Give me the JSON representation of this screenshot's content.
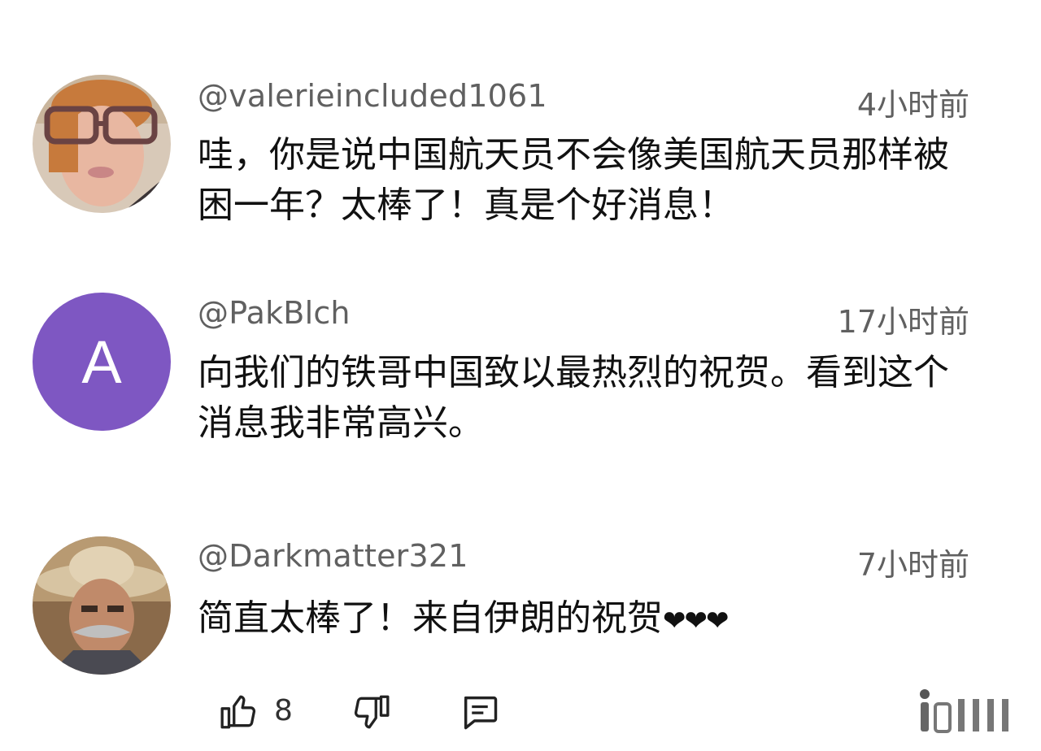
{
  "comments": [
    {
      "handle": "@valerieincluded1061",
      "time": "4小时前",
      "text": "哇，你是说中国航天员不会像美国航天员那样被困一年？太棒了！真是个好消息！",
      "avatar": "photo"
    },
    {
      "handle": "@PakBlch",
      "time": "17小时前",
      "text": "向我们的铁哥中国致以最热烈的祝贺。看到这个消息我非常高兴。",
      "avatar": {
        "letter": "A",
        "color": "#7e57c2"
      }
    },
    {
      "handle": "@Darkmatter321",
      "time": "7小时前",
      "text": "简直太棒了！来自伊朗的祝贺",
      "emoji": "❤❤❤",
      "avatar": "photo"
    }
  ],
  "actions": {
    "like_icon": "thumbs-up-icon",
    "like_count": "8",
    "dislike_icon": "thumbs-down-icon",
    "reply_icon": "comment-icon"
  }
}
